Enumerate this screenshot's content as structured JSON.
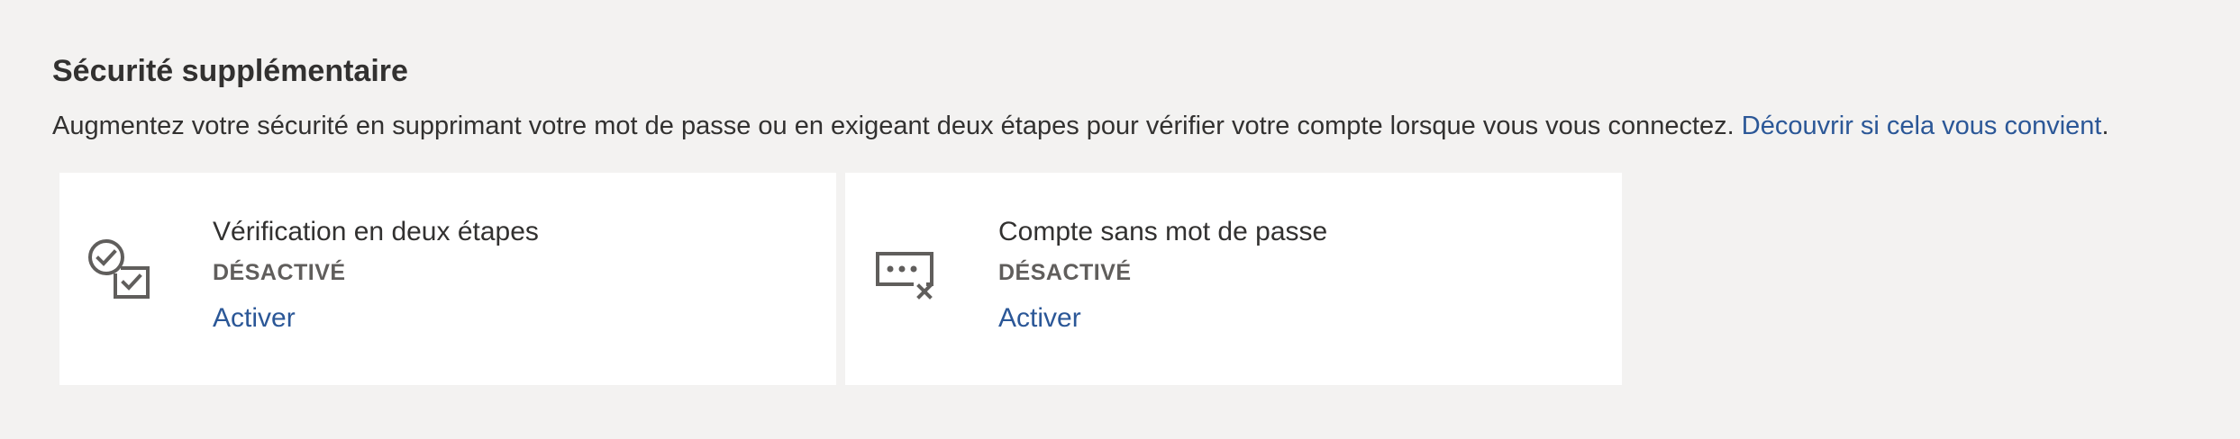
{
  "section": {
    "title": "Sécurité supplémentaire",
    "description": "Augmentez votre sécurité en supprimant votre mot de passe ou en exigeant deux étapes pour vérifier votre compte lorsque vous vous connectez. ",
    "link_text": "Découvrir si cela vous convient",
    "link_suffix": "."
  },
  "cards": [
    {
      "icon": "two-step-verification-icon",
      "title": "Vérification en deux étapes",
      "status": "DÉSACTIVÉ",
      "action": "Activer"
    },
    {
      "icon": "passwordless-account-icon",
      "title": "Compte sans mot de passe",
      "status": "DÉSACTIVÉ",
      "action": "Activer"
    }
  ],
  "colors": {
    "background": "#f3f2f1",
    "card": "#ffffff",
    "link": "#2b5797",
    "text": "#323130",
    "status": "#605e5c",
    "icon": "#605e5c"
  }
}
